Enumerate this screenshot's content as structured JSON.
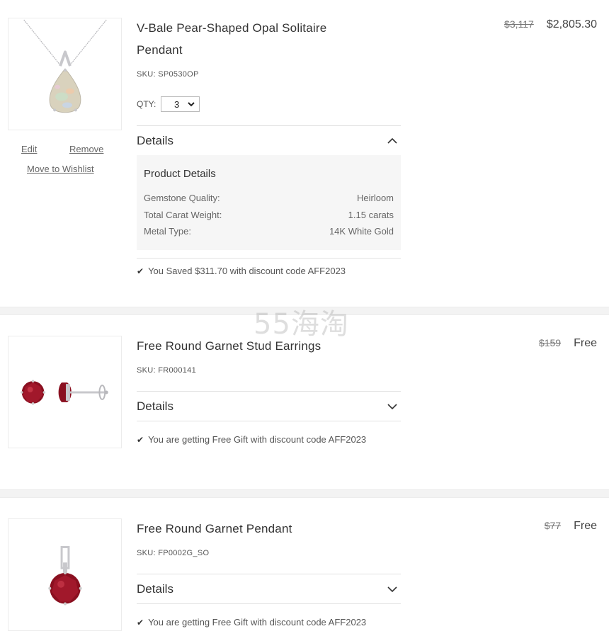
{
  "items": [
    {
      "title": "V-Bale Pear-Shaped Opal Solitaire Pendant",
      "sku": "SKU: SP0530OP",
      "price_old": "$3,117",
      "price_new": "$2,805.30",
      "qty_label": "QTY:",
      "qty_value": "3",
      "edit_label": "Edit",
      "remove_label": "Remove",
      "wishlist_label": "Move to Wishlist",
      "details_label": "Details",
      "panel_title": "Product Details",
      "specs": [
        {
          "label": "Gemstone Quality:",
          "value": "Heirloom"
        },
        {
          "label": "Total Carat Weight:",
          "value": "1.15 carats"
        },
        {
          "label": "Metal Type:",
          "value": "14K White Gold"
        }
      ],
      "saved_text": "You Saved $311.70 with discount code AFF2023"
    },
    {
      "title": "Free Round Garnet Stud Earrings",
      "sku": "SKU: FR000141",
      "price_old": "$159",
      "price_new": "Free",
      "details_label": "Details",
      "saved_text": "You are getting Free Gift with discount code AFF2023"
    },
    {
      "title": "Free Round Garnet Pendant",
      "sku": "SKU: FP0002G_SO",
      "price_old": "$77",
      "price_new": "Free",
      "details_label": "Details",
      "saved_text": "You are getting Free Gift with discount code AFF2023"
    }
  ],
  "watermark": "55海淘",
  "icons": {
    "check": "check-icon",
    "chevron_up": "chevron-up-icon",
    "chevron_down": "chevron-down-icon"
  },
  "colors": {
    "garnet": "#8a1020",
    "opal": "#d8d0c0",
    "metal": "#c8c8cc"
  }
}
